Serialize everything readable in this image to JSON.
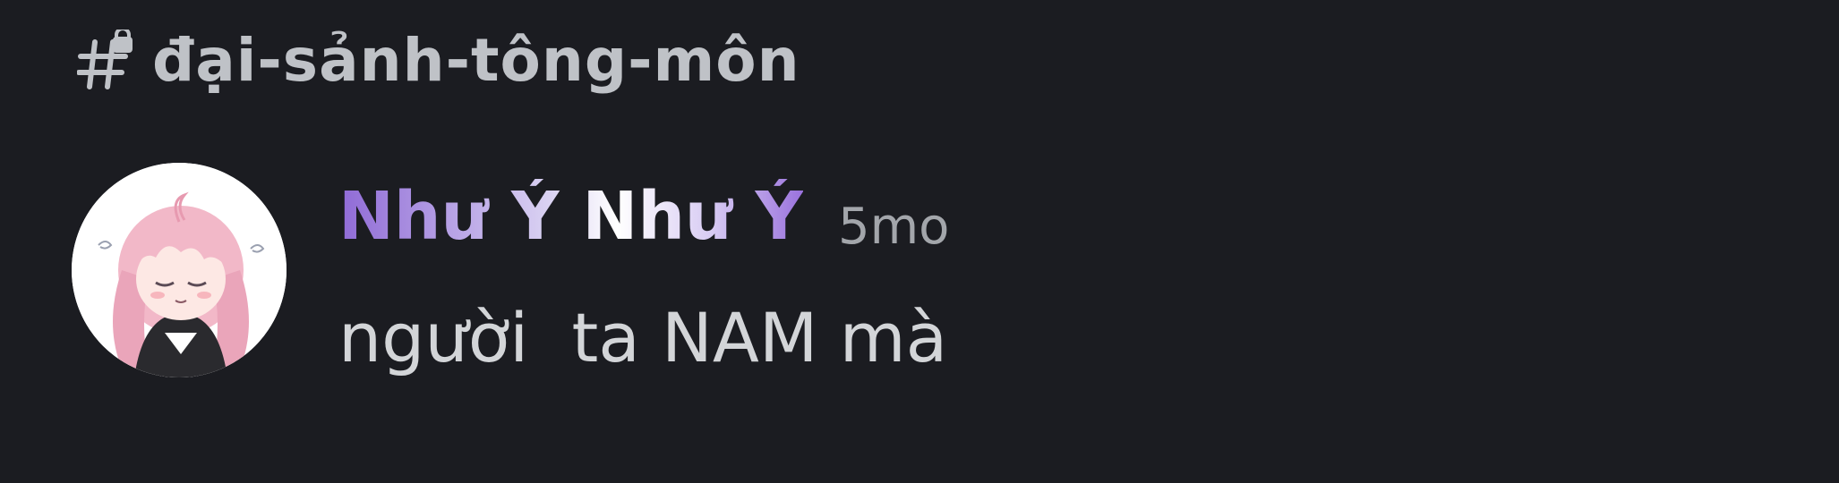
{
  "channel": {
    "icon": "text-channel-locked-icon",
    "name": "đại-sảnh-tông-môn"
  },
  "message": {
    "avatar_icon": "anime-girl-avatar",
    "username": "Như Ý Như Ý",
    "timestamp": "5mo",
    "text": "người  ta NAM mà"
  },
  "colors": {
    "background": "#1b1c21",
    "channel_text": "#bfc2c7",
    "username_gradient_start": "#8f6ad6",
    "timestamp": "#a3a6ab",
    "message_text": "#d3d5d8"
  }
}
